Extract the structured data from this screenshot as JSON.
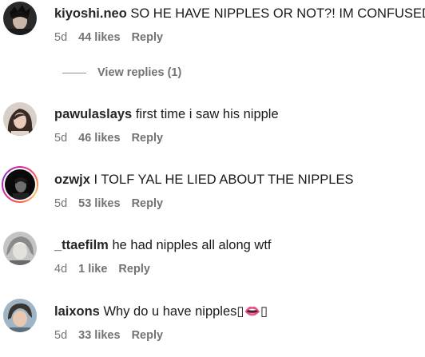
{
  "comments": [
    {
      "username": "kiyoshi.neo",
      "text": "SO HE HAVE NIPPLES OR NOT?! IM CONFUSED",
      "age": "5d",
      "likes": "44 likes",
      "reply": "Reply",
      "view_replies": "View replies (1)"
    },
    {
      "username": "pawulaslays",
      "text": "first time i saw his nipple",
      "age": "5d",
      "likes": "46 likes",
      "reply": "Reply"
    },
    {
      "username": "ozwjx",
      "text": "I TOLF YAL HE LIED ABOUT THE NIPPLES",
      "age": "5d",
      "likes": "53 likes",
      "reply": "Reply"
    },
    {
      "username": "_ttaefilm",
      "text": "he had nipples all along wtf",
      "age": "4d",
      "likes": "1 like",
      "reply": "Reply"
    },
    {
      "username": "laixons",
      "text": "Why do u have nipples▯👄▯",
      "age": "5d",
      "likes": "33 likes",
      "reply": "Reply"
    }
  ],
  "colors": {
    "text": "#262626",
    "muted": "#737373",
    "story_ring_start": "#d6249f",
    "story_ring_end": "#fdc468"
  }
}
